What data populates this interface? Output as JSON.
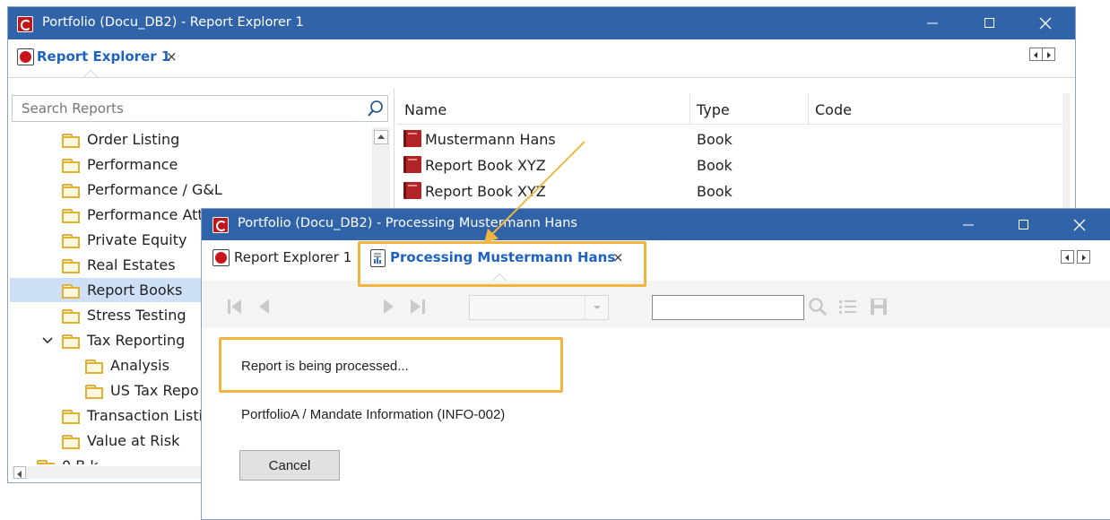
{
  "window1": {
    "title": "Portfolio  (Docu_DB2) - Report Explorer 1",
    "tab_label": "Report Explorer 1",
    "tab_close": "×",
    "search": {
      "placeholder": "Search Reports"
    },
    "tree": [
      {
        "label": "Order Listing"
      },
      {
        "label": "Performance"
      },
      {
        "label": "Performance / G&L"
      },
      {
        "label": "Performance Att"
      },
      {
        "label": "Private Equity"
      },
      {
        "label": "Real Estates"
      },
      {
        "label": "Report Books",
        "selected": true
      },
      {
        "label": "Stress Testing"
      },
      {
        "label": "Tax Reporting",
        "expanded": true
      },
      {
        "label": "Analysis"
      },
      {
        "label": "US Tax Repo"
      },
      {
        "label": "Transaction Listi"
      },
      {
        "label": "Value at Risk"
      },
      {
        "label": "0 B   k"
      }
    ],
    "table": {
      "columns": [
        "Name",
        "Type",
        "Code"
      ],
      "rows": [
        {
          "name": "Mustermann Hans",
          "type": "Book",
          "code": ""
        },
        {
          "name": "Report Book XYZ",
          "type": "Book",
          "code": ""
        },
        {
          "name": "Report Book XYZ",
          "type": "Book",
          "code": ""
        }
      ]
    }
  },
  "window2": {
    "title": "Portfolio  (Docu_DB2) - Processing Mustermann Hans",
    "tabs": [
      {
        "label": "Report Explorer 1",
        "active": false
      },
      {
        "label": "Processing Mustermann Hans",
        "active": true,
        "close": "×"
      }
    ],
    "status_message": "Report is being processed...",
    "report_path": "PortfolioA / Mandate Information (INFO-002)",
    "cancel_label": "Cancel"
  },
  "colors": {
    "titlebar": "#3163a8",
    "accent_tab_text": "#1f63c2",
    "highlight": "#f0b53e",
    "selection": "#cde0f6",
    "folder": "#e2b134",
    "book": "#b02426"
  }
}
